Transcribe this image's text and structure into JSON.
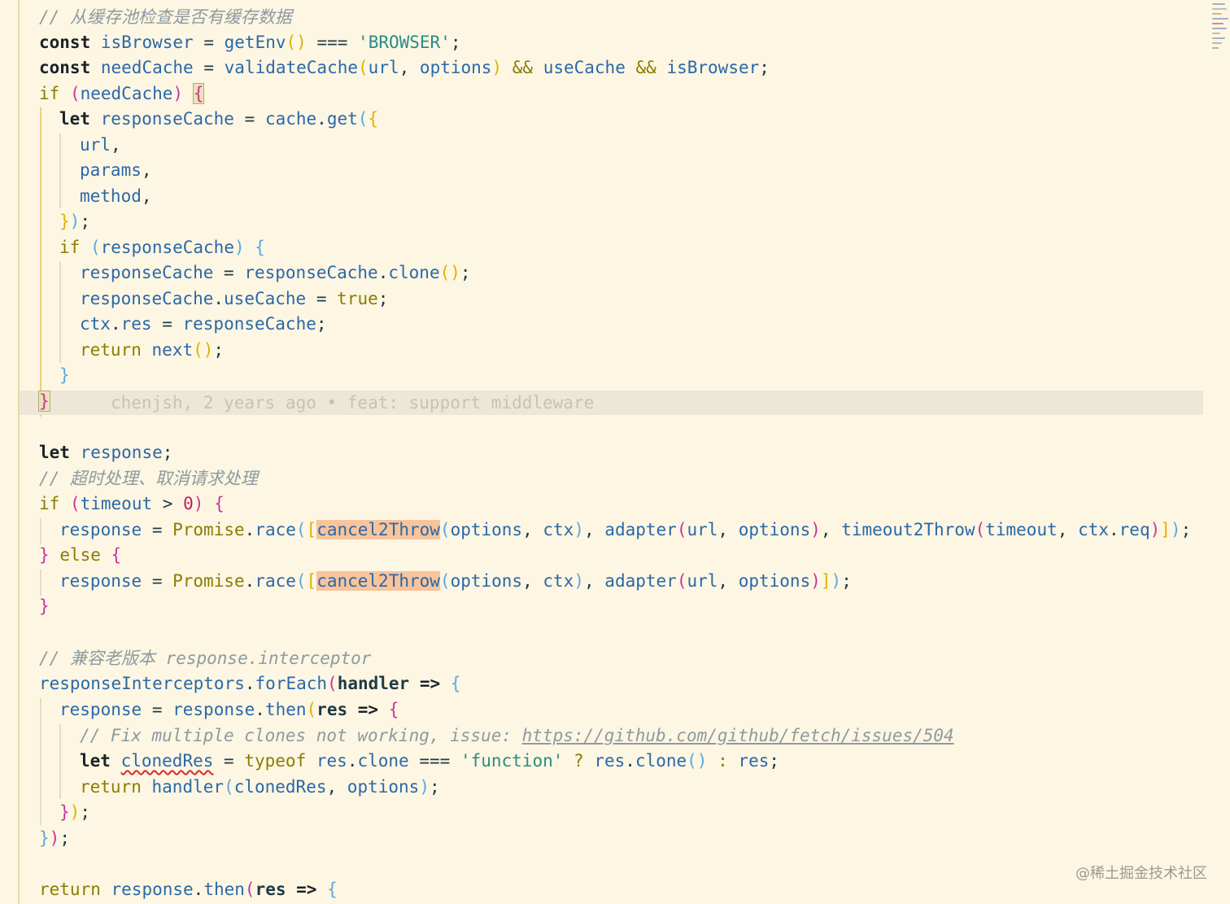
{
  "editor": {
    "line_1_comment": "// 从缓存池检查是否有缓存数据",
    "browser_string": "'BROWSER'",
    "blame": "chenjsh, 2 years ago • feat: support middleware",
    "line_16_comment": "// 超时处理、取消请求处理",
    "timeout_zero": "0",
    "line_23_comment": "// 兼容老版本 response.interceptor",
    "fix_comment_prefix": "// Fix multiple clones not working, issue: ",
    "fix_comment_url": "https://github.com/github/fetch/issues/504",
    "function_string": "'function'"
  },
  "watermark": "@稀土掘金技术社区",
  "colors": {
    "background": "#fdf6e3",
    "keyword": "#1a2328",
    "identifier": "#2a68a8",
    "string": "#2a8c84",
    "comment": "#8d9aa0",
    "highlight": "#f7c49b"
  }
}
